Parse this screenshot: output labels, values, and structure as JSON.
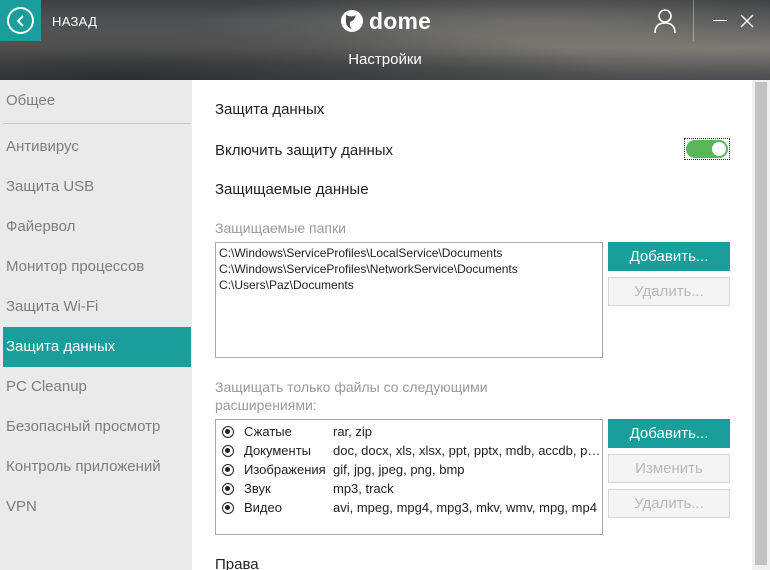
{
  "header": {
    "back_label": "НАЗАД",
    "logo_text": "dome",
    "page_title": "Настройки",
    "accent_color": "#1a9e9b"
  },
  "sidebar": {
    "items": [
      {
        "label": "Общее",
        "active": false
      },
      {
        "label": "Антивирус",
        "active": false
      },
      {
        "label": "Защита USB",
        "active": false
      },
      {
        "label": "Файервол",
        "active": false
      },
      {
        "label": "Монитор процессов",
        "active": false
      },
      {
        "label": "Защита Wi-Fi",
        "active": false
      },
      {
        "label": "Защита данных",
        "active": true
      },
      {
        "label": "PC Cleanup",
        "active": false
      },
      {
        "label": "Безопасный просмотр",
        "active": false
      },
      {
        "label": "Контроль приложений",
        "active": false
      },
      {
        "label": "VPN",
        "active": false
      }
    ]
  },
  "main": {
    "section_title": "Защита данных",
    "enable_label": "Включить защиту данных",
    "enable_on": true,
    "protected_title": "Защищаемые данные",
    "folders_label": "Защищаемые папки",
    "folders": [
      "C:\\Windows\\ServiceProfiles\\LocalService\\Documents",
      "C:\\Windows\\ServiceProfiles\\NetworkService\\Documents",
      "C:\\Users\\Paz\\Documents"
    ],
    "folders_add": "Добавить...",
    "folders_remove": "Удалить...",
    "ext_label_1": "Защищать только файлы со следующими",
    "ext_label_2": "расширениями:",
    "extensions": [
      {
        "name": "Сжатые",
        "exts": "rar, zip"
      },
      {
        "name": "Документы",
        "exts": "doc, docx, xls, xlsx, ppt, pptx, mdb, accdb, pdf, ..."
      },
      {
        "name": "Изображения",
        "exts": "gif, jpg, jpeg, png, bmp"
      },
      {
        "name": "Звук",
        "exts": "mp3, track"
      },
      {
        "name": "Видео",
        "exts": "avi, mpeg, mpg4, mpg3, mkv, wmv, mpg, mp4"
      }
    ],
    "ext_add": "Добавить...",
    "ext_edit": "Изменить",
    "ext_remove": "Удалить...",
    "rights_title": "Права"
  }
}
